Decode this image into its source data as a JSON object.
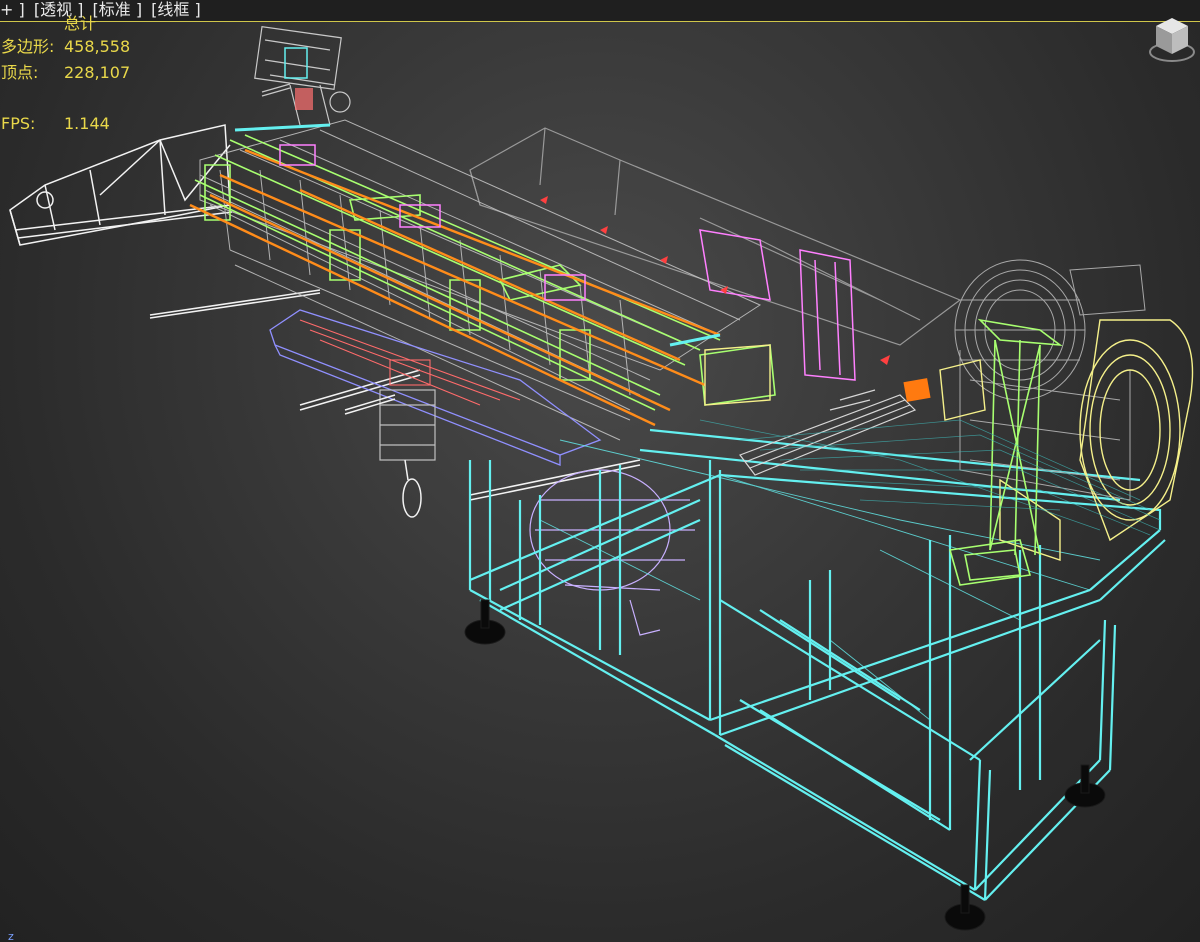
{
  "viewport": {
    "menus": [
      {
        "label": "+ ]"
      },
      {
        "label": "[透视 ]"
      },
      {
        "label": "[标准 ]"
      },
      {
        "label": "[线框 ]"
      }
    ]
  },
  "stats": {
    "header": "总计",
    "polygons_label": "多边形:",
    "polygons_value": "458,558",
    "vertices_label": "顶点:",
    "vertices_value": "228,107",
    "fps_label": "FPS:",
    "fps_value": "1.144"
  },
  "axis_label": "z",
  "colors": {
    "frame": "#64f0f0",
    "feeder": "#ffffff",
    "green": "#a8ff70",
    "magenta": "#ff80ff",
    "orange": "#ff8c1a",
    "grey": "#b8b8b8",
    "yellow": "#f5f08a",
    "purple": "#c8b0ff",
    "blue": "#9090ff",
    "red": "#ff6060",
    "stats_text": "#e9d84a"
  }
}
